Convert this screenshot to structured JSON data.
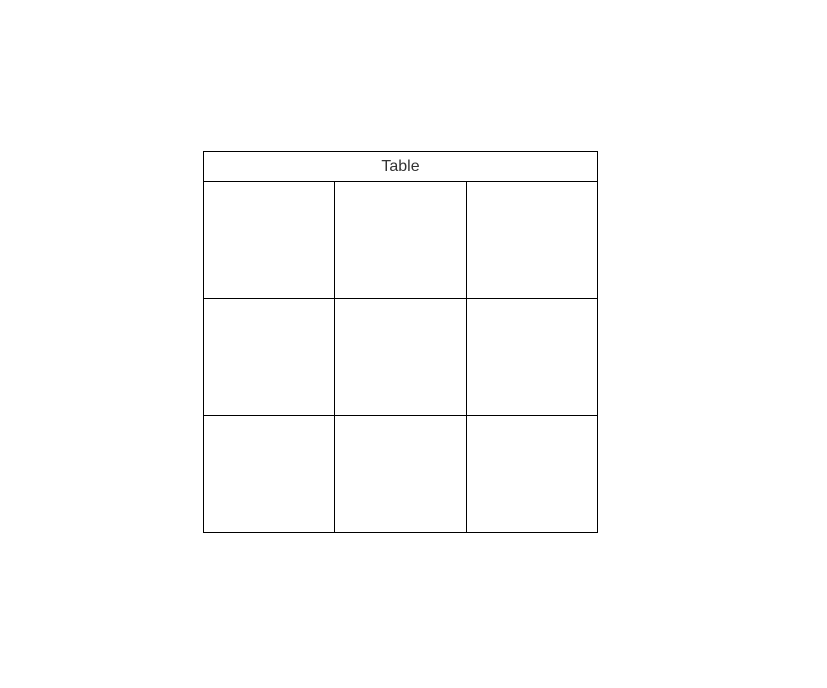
{
  "table": {
    "title": "Table",
    "rows": [
      [
        "",
        "",
        ""
      ],
      [
        "",
        "",
        ""
      ],
      [
        "",
        "",
        ""
      ]
    ]
  }
}
